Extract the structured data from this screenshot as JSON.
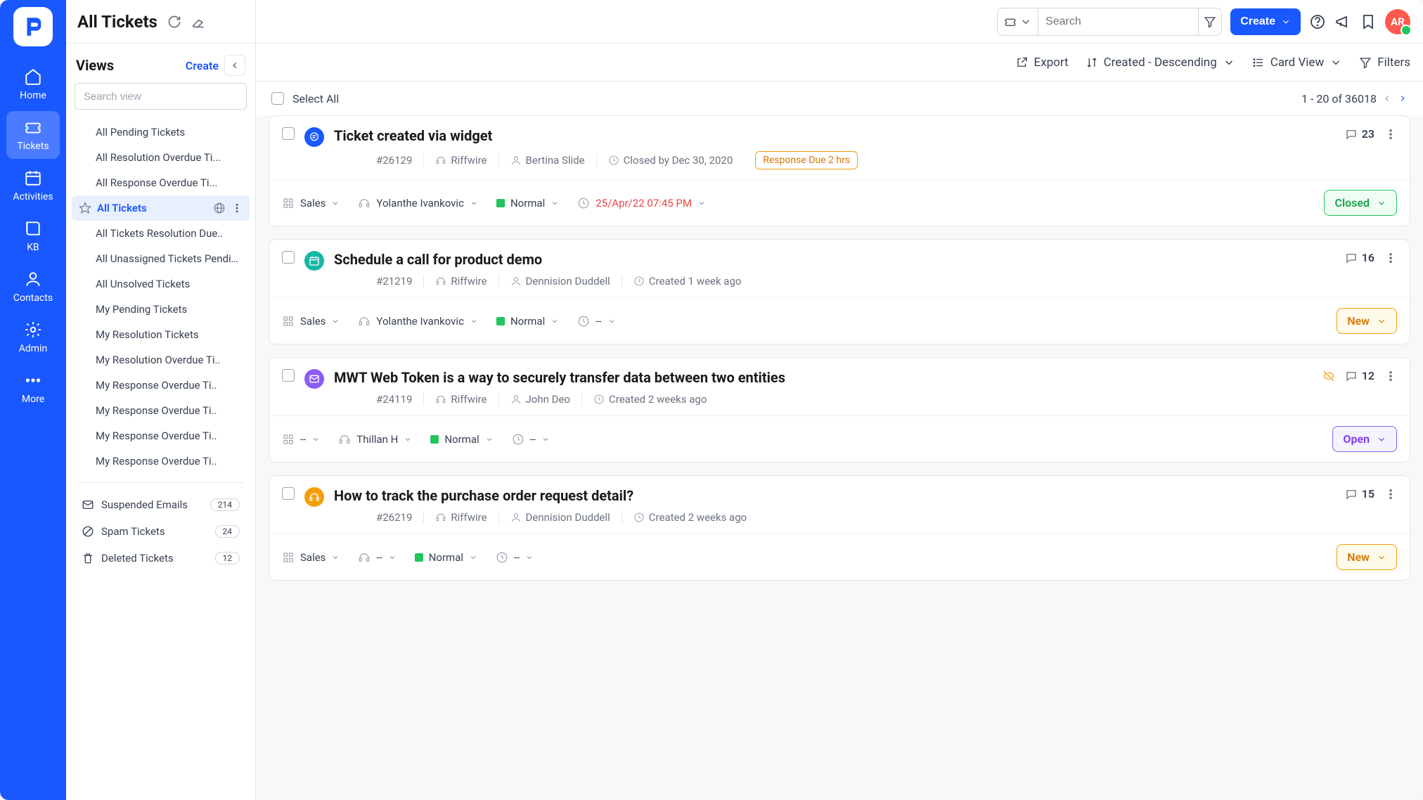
{
  "nav": {
    "items": [
      {
        "label": "Home"
      },
      {
        "label": "Tickets"
      },
      {
        "label": "Activities"
      },
      {
        "label": "KB"
      },
      {
        "label": "Contacts"
      },
      {
        "label": "Admin"
      },
      {
        "label": "More"
      }
    ]
  },
  "header": {
    "title": "All Tickets",
    "search_placeholder": "Search",
    "create_label": "Create",
    "avatar_initials": "AR"
  },
  "views": {
    "heading": "Views",
    "create_label": "Create",
    "search_placeholder": "Search view",
    "items": [
      "All Pending Tickets",
      "All Resolution Overdue  Ti...",
      "All Response Overdue  Ti...",
      "All Tickets",
      "All Tickets Resolution Due..",
      "All Unassigned Tickets Pending",
      "All Unsolved Tickets",
      "My Pending Tickets",
      "My Resolution Tickets",
      "My Resolution Overdue Ti..",
      "My Response Overdue Ti..",
      "My Response Overdue Ti..",
      "My Response Overdue Ti..",
      "My Response Overdue Ti.."
    ],
    "active_index": 3,
    "bottom": [
      {
        "label": "Suspended Emails",
        "count": "214"
      },
      {
        "label": "Spam Tickets",
        "count": "24"
      },
      {
        "label": "Deleted Tickets",
        "count": "12"
      }
    ]
  },
  "toolbar": {
    "export": "Export",
    "sort": "Created - Descending",
    "view": "Card View",
    "filters": "Filters"
  },
  "list": {
    "select_all": "Select All",
    "pager": "1 - 20 of 36018"
  },
  "tickets": [
    {
      "avatar": "blue",
      "icon": "chat",
      "title": "Ticket created via widget",
      "id": "#26129",
      "company": "Riffwire",
      "contact": "Bertina Slide",
      "time_label": "Closed by Dec 30, 2020",
      "tag": "Response Due 2 hrs",
      "comments": "23",
      "group": "Sales",
      "assignee": "Yolanthe Ivankovic",
      "priority": "Normal",
      "date": "25/Apr/22 07:45 PM",
      "date_red": true,
      "status": "Closed",
      "status_class": "closed"
    },
    {
      "avatar": "teal",
      "icon": "calendar",
      "title": "Schedule a call for product demo",
      "id": "#21219",
      "company": "Riffwire",
      "contact": "Dennision Duddell",
      "time_label": "Created 1 week ago",
      "tag": "",
      "comments": "16",
      "group": "Sales",
      "assignee": "Yolanthe Ivankovic",
      "priority": "Normal",
      "date": "--",
      "date_red": false,
      "status": "New",
      "status_class": "new"
    },
    {
      "avatar": "purple",
      "icon": "mail",
      "title": "MWT  Web Token is a way to securely transfer data between two entities",
      "id": "#24119",
      "company": "Riffwire",
      "contact": "John Deo",
      "time_label": "Created 2 weeks ago",
      "tag": "",
      "comments": "12",
      "hidden": true,
      "group": "--",
      "assignee": "Thillan H",
      "priority": "Normal",
      "date": "--",
      "date_red": false,
      "status": "Open",
      "status_class": "open"
    },
    {
      "avatar": "orange",
      "icon": "headset",
      "title": "How to track the purchase order request detail?",
      "id": "#26219",
      "company": "Riffwire",
      "contact": "Dennision Duddell",
      "time_label": "Created 2 weeks ago",
      "tag": "",
      "comments": "15",
      "group": "Sales",
      "assignee": "--",
      "priority": "Normal",
      "date": "--",
      "date_red": false,
      "status": "New",
      "status_class": "new"
    }
  ]
}
